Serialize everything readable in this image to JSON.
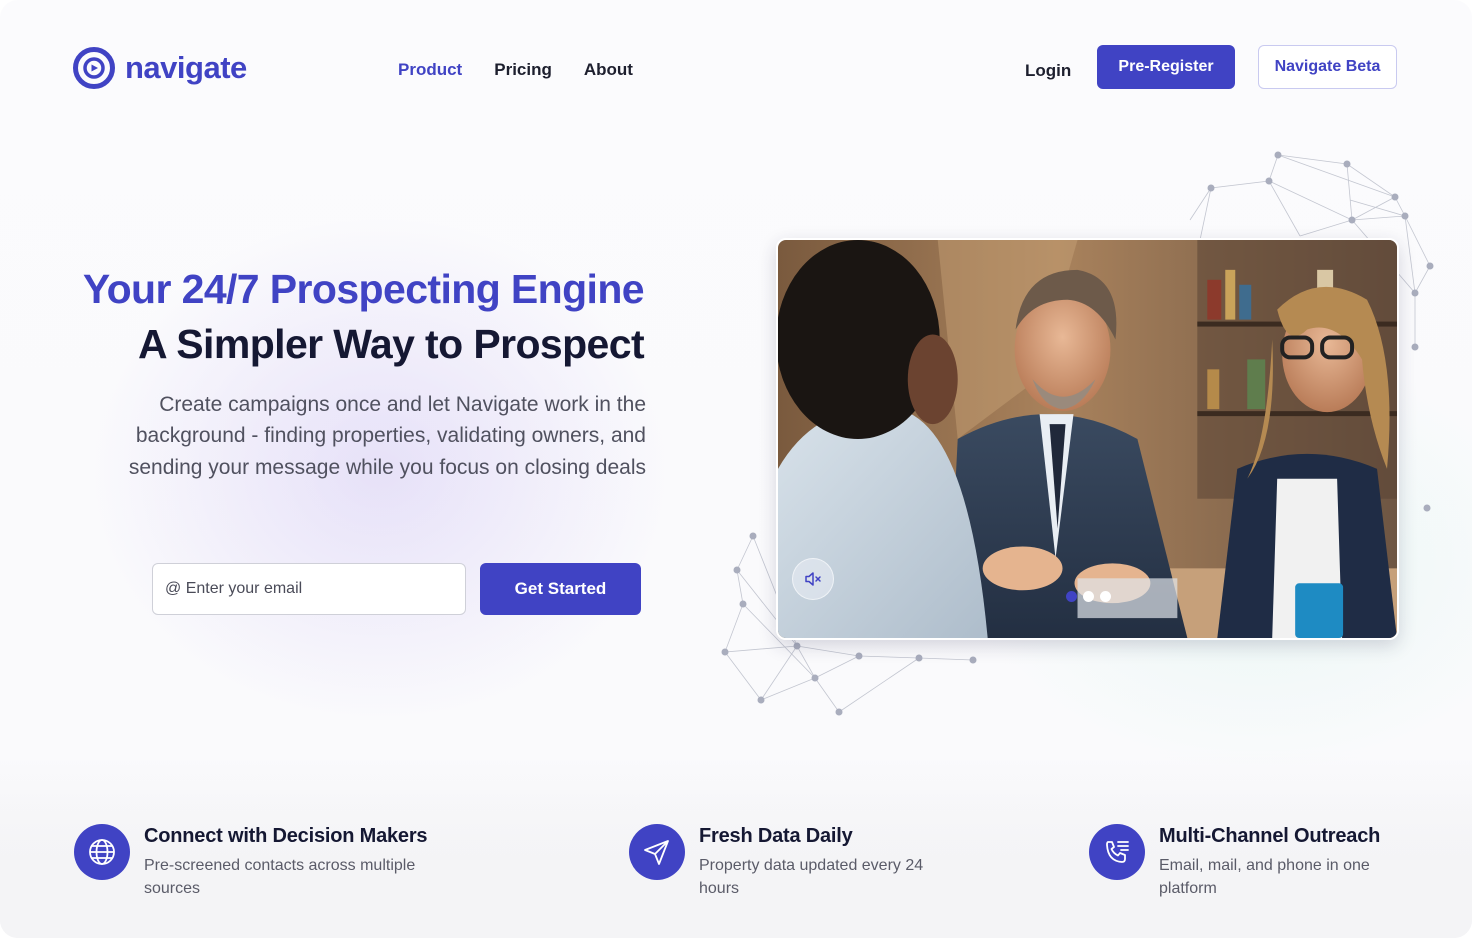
{
  "brand": {
    "name": "navigate",
    "accent": "#4043c4"
  },
  "nav": {
    "links": [
      {
        "label": "Product",
        "active": true
      },
      {
        "label": "Pricing",
        "active": false
      },
      {
        "label": "About",
        "active": false
      }
    ],
    "login_label": "Login",
    "preregister_label": "Pre-Register",
    "beta_label": "Navigate Beta"
  },
  "hero": {
    "title_line1": "Your 24/7 Prospecting Engine",
    "title_line2": "A Simpler Way to Prospect",
    "description": "Create campaigns once and let Navigate work in the background - finding properties, validating owners, and sending your message while you focus on closing deals",
    "email_placeholder": "@ Enter your email",
    "cta_label": "Get Started"
  },
  "video": {
    "muted": true,
    "slides": 3,
    "active_slide": 1
  },
  "features": [
    {
      "icon": "globe-icon",
      "title": "Connect with Decision Makers",
      "description": "Pre-screened contacts across multiple sources"
    },
    {
      "icon": "send-icon",
      "title": "Fresh Data Daily",
      "description": "Property data updated every 24 hours"
    },
    {
      "icon": "phone-list-icon",
      "title": "Multi-Channel Outreach",
      "description": "Email, mail, and phone in one platform"
    }
  ]
}
